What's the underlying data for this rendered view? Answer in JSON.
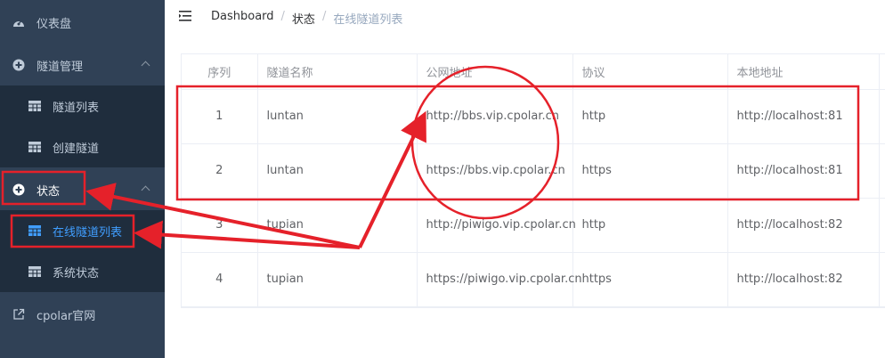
{
  "sidebar": {
    "items": [
      {
        "label": "仪表盘",
        "icon": "dashboard-icon"
      },
      {
        "label": "隧道管理",
        "icon": "plus-circle-icon"
      },
      {
        "label": "状态",
        "icon": "plus-circle-icon"
      },
      {
        "label": "cpolar官网",
        "icon": "external-link-icon"
      }
    ],
    "sub_tunnel": [
      {
        "label": "隧道列表",
        "icon": "table-icon"
      },
      {
        "label": "创建隧道",
        "icon": "table-icon"
      }
    ],
    "sub_status": [
      {
        "label": "在线隧道列表",
        "icon": "table-icon",
        "active": true
      },
      {
        "label": "系统状态",
        "icon": "table-icon"
      }
    ]
  },
  "breadcrumb": [
    "Dashboard",
    "状态",
    "在线隧道列表"
  ],
  "table": {
    "headers": [
      "序列",
      "隧道名称",
      "公网地址",
      "协议",
      "本地地址"
    ],
    "rows": [
      [
        "1",
        "luntan",
        "http://bbs.vip.cpolar.cn",
        "http",
        "http://localhost:81"
      ],
      [
        "2",
        "luntan",
        "https://bbs.vip.cpolar.cn",
        "https",
        "http://localhost:81"
      ],
      [
        "3",
        "tupian",
        "http://piwigo.vip.cpolar.cn",
        "http",
        "http://localhost:82"
      ],
      [
        "4",
        "tupian",
        "https://piwigo.vip.cpolar.cn",
        "https",
        "http://localhost:82"
      ]
    ]
  },
  "colors": {
    "sidebar_bg": "#304156",
    "submenu_bg": "#1f2d3d",
    "active": "#409eff",
    "annotation": "#e5212a"
  }
}
